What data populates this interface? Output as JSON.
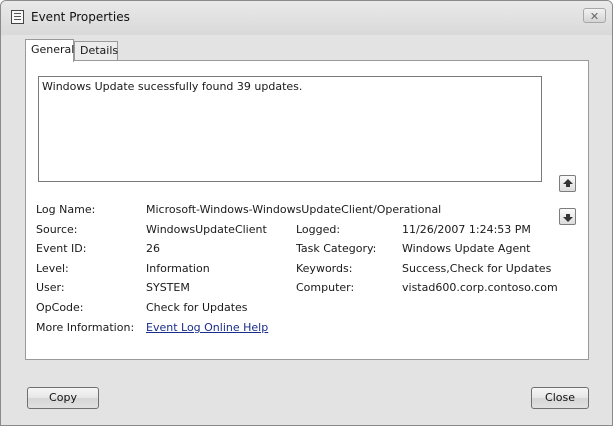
{
  "window": {
    "title": "Event Properties",
    "close_glyph": "✕"
  },
  "tabs": [
    {
      "label": "General"
    },
    {
      "label": "Details"
    }
  ],
  "description": "Windows Update sucessfully found 39 updates.",
  "fields": {
    "log_name": {
      "label": "Log Name:",
      "value": "Microsoft-Windows-WindowsUpdateClient/Operational"
    },
    "source": {
      "label": "Source:",
      "value": "WindowsUpdateClient"
    },
    "logged": {
      "label": "Logged:",
      "value": "11/26/2007 1:24:53 PM"
    },
    "event_id": {
      "label": "Event ID:",
      "value": "26"
    },
    "task_category": {
      "label": "Task Category:",
      "value": "Windows Update Agent"
    },
    "level": {
      "label": "Level:",
      "value": "Information"
    },
    "keywords": {
      "label": "Keywords:",
      "value": "Success,Check for Updates"
    },
    "user": {
      "label": "User:",
      "value": "SYSTEM"
    },
    "computer": {
      "label": "Computer:",
      "value": "vistad600.corp.contoso.com"
    },
    "opcode": {
      "label": "OpCode:",
      "value": "Check for Updates"
    },
    "more_info": {
      "label": "More Information:",
      "value": "Event Log Online Help"
    }
  },
  "buttons": {
    "copy": "Copy",
    "close": "Close"
  }
}
